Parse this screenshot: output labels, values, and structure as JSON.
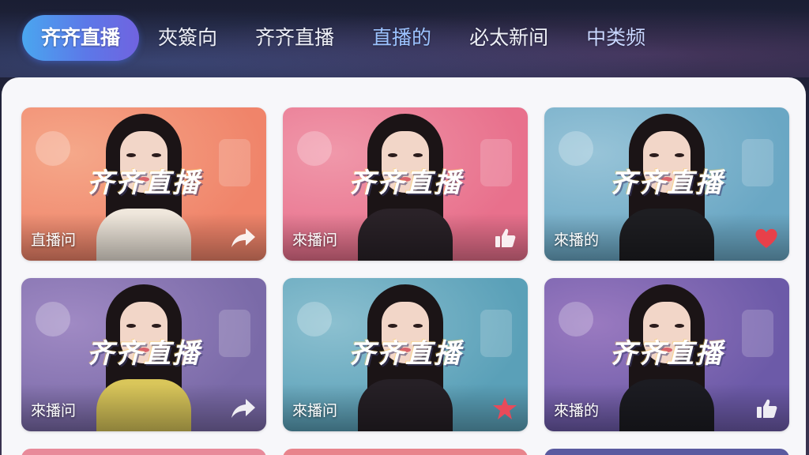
{
  "tabs": [
    {
      "label": "齐齐直播",
      "style": "active"
    },
    {
      "label": "夾簽向",
      "style": "normal"
    },
    {
      "label": "齐齐直播",
      "style": "normal"
    },
    {
      "label": "直播的",
      "style": "blue"
    },
    {
      "label": "必太新间",
      "style": "normal"
    },
    {
      "label": "中类频",
      "style": "lightblue"
    }
  ],
  "watermark": "齐齐直播",
  "cards": [
    {
      "caption": "直播问",
      "action_icon": "share-icon",
      "bg": "#f0846a",
      "bg2": "#f5a88a",
      "outfit": "#efe7dc"
    },
    {
      "caption": "來播问",
      "action_icon": "thumbs-up-icon",
      "bg": "#e8708c",
      "bg2": "#f098aa",
      "outfit": "#2a2228"
    },
    {
      "caption": "來播的",
      "action_icon": "heart-icon",
      "bg": "#6aa7c4",
      "bg2": "#98c4d8",
      "outfit": "#1e1e22"
    },
    {
      "caption": "來播问",
      "action_icon": "share-icon",
      "bg": "#7a6aa8",
      "bg2": "#a08ac4",
      "outfit": "#d9c65a"
    },
    {
      "caption": "來播问",
      "action_icon": "star-icon",
      "bg": "#5aa0b8",
      "bg2": "#8cc0d0",
      "outfit": "#262026"
    },
    {
      "caption": "來播的",
      "action_icon": "thumbs-up-icon",
      "bg": "#6c5aa8",
      "bg2": "#9a7ac0",
      "outfit": "#1c1c22"
    }
  ],
  "colors": {
    "accent": "#5c78e8",
    "panel": "#f7f7fa",
    "heart": "#e8404a",
    "star": "#e84a5a"
  }
}
